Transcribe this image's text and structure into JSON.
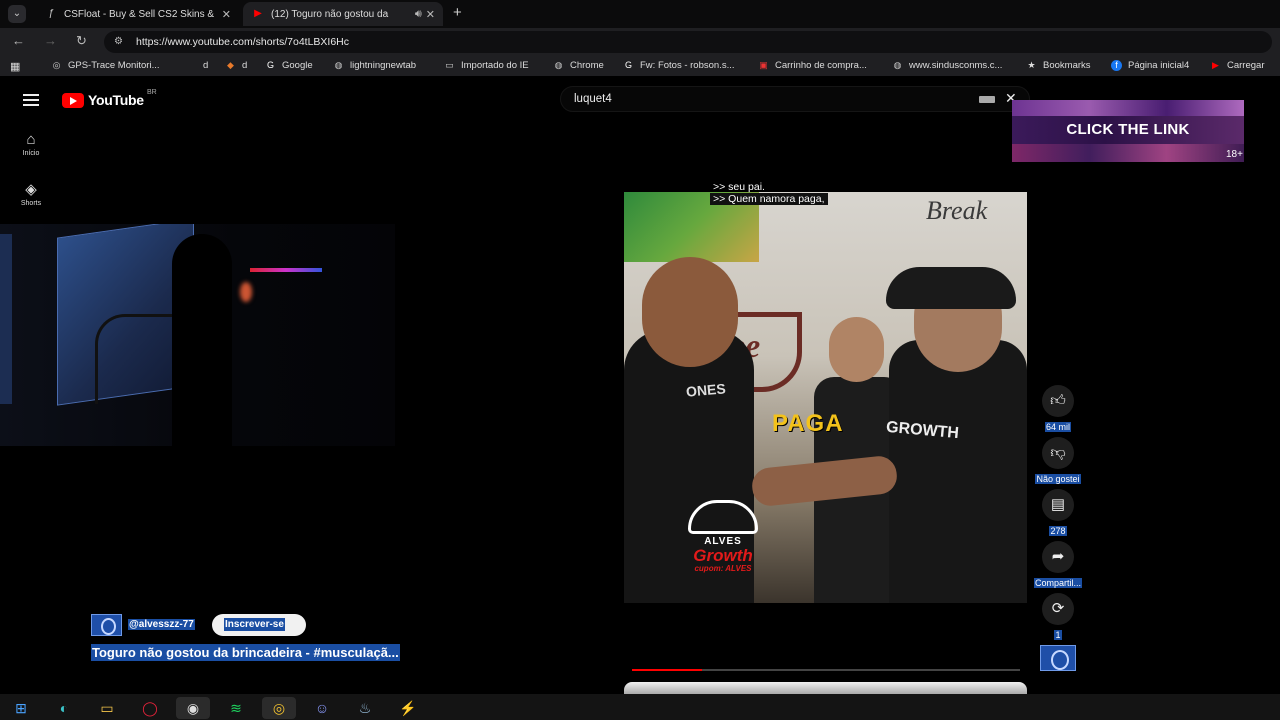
{
  "browser": {
    "tabs": [
      {
        "title": "CSFloat - Buy & Sell CS2 Skins &",
        "favicon": "csfloat-icon",
        "active": false
      },
      {
        "title": "(12) Toguro não gostou da",
        "favicon": "youtube-icon",
        "active": true
      }
    ],
    "url": "https://www.youtube.com/shorts/7o4tLBXI6Hc",
    "bookmarks": [
      {
        "label": "GPS-Trace Monitori...",
        "icon": "gps-icon"
      },
      {
        "label": "d",
        "icon": ""
      },
      {
        "label": "d",
        "icon": "shield-icon"
      },
      {
        "label": "Google",
        "icon": "google-icon"
      },
      {
        "label": "lightningnewtab",
        "icon": "globe-icon"
      },
      {
        "label": "Importado do IE",
        "icon": "folder-icon"
      },
      {
        "label": "Chrome",
        "icon": "globe-icon"
      },
      {
        "label": "Fw: Fotos - robson.s...",
        "icon": "google-icon"
      },
      {
        "label": "Carrinho de compra...",
        "icon": "store-icon"
      },
      {
        "label": "www.sindusconms.c...",
        "icon": "globe-icon"
      },
      {
        "label": "Bookmarks",
        "icon": "star-icon"
      },
      {
        "label": "Página inicial4",
        "icon": "facebook-icon"
      },
      {
        "label": "Carregar",
        "icon": "youtube-icon"
      }
    ]
  },
  "youtube": {
    "logo_text": "YouTube",
    "region": "BR",
    "sidebar": [
      {
        "label": "Início",
        "icon": "home-icon"
      },
      {
        "label": "Shorts",
        "icon": "shorts-icon"
      }
    ],
    "search_query": "luquet4"
  },
  "ad": {
    "text": "CLICK THE LINK",
    "age": "18+"
  },
  "short": {
    "captions": [
      ">> seu pai.",
      ">> Quem namora paga,"
    ],
    "overlay_word": "PAGA",
    "wall_text": "Break",
    "wall_coffee": "ffee",
    "shirt_left": "ONES",
    "shirt_right": "GROWTH",
    "brand": {
      "name": "ALVES",
      "product": "Growth",
      "coupon": "cupom: ALVES"
    },
    "progress": 0.18,
    "channel": "@alvesszz-77",
    "subscribe_label": "Inscrever-se",
    "title": "Toguro não gostou da brincadeira - #musculaçã..."
  },
  "actions": [
    {
      "label": "64 mil",
      "icon": "thumbs-up-icon"
    },
    {
      "label": "Não gostei",
      "icon": "thumbs-down-icon"
    },
    {
      "label": "278",
      "icon": "comment-icon"
    },
    {
      "label": "Compartil...",
      "icon": "share-icon"
    },
    {
      "label": "1",
      "icon": "remix-icon"
    }
  ],
  "taskbar": [
    {
      "name": "windows-start-icon",
      "glyph": "⊞"
    },
    {
      "name": "edge-icon",
      "glyph": "◐"
    },
    {
      "name": "file-explorer-icon",
      "glyph": "▭"
    },
    {
      "name": "opera-icon",
      "glyph": "◯"
    },
    {
      "name": "recorder-icon",
      "glyph": "◉"
    },
    {
      "name": "spotify-icon",
      "glyph": "≋"
    },
    {
      "name": "chrome-icon",
      "glyph": "◎"
    },
    {
      "name": "discord-icon",
      "glyph": "☺"
    },
    {
      "name": "steam-icon",
      "glyph": "♨"
    },
    {
      "name": "app-icon",
      "glyph": "⚡"
    }
  ]
}
